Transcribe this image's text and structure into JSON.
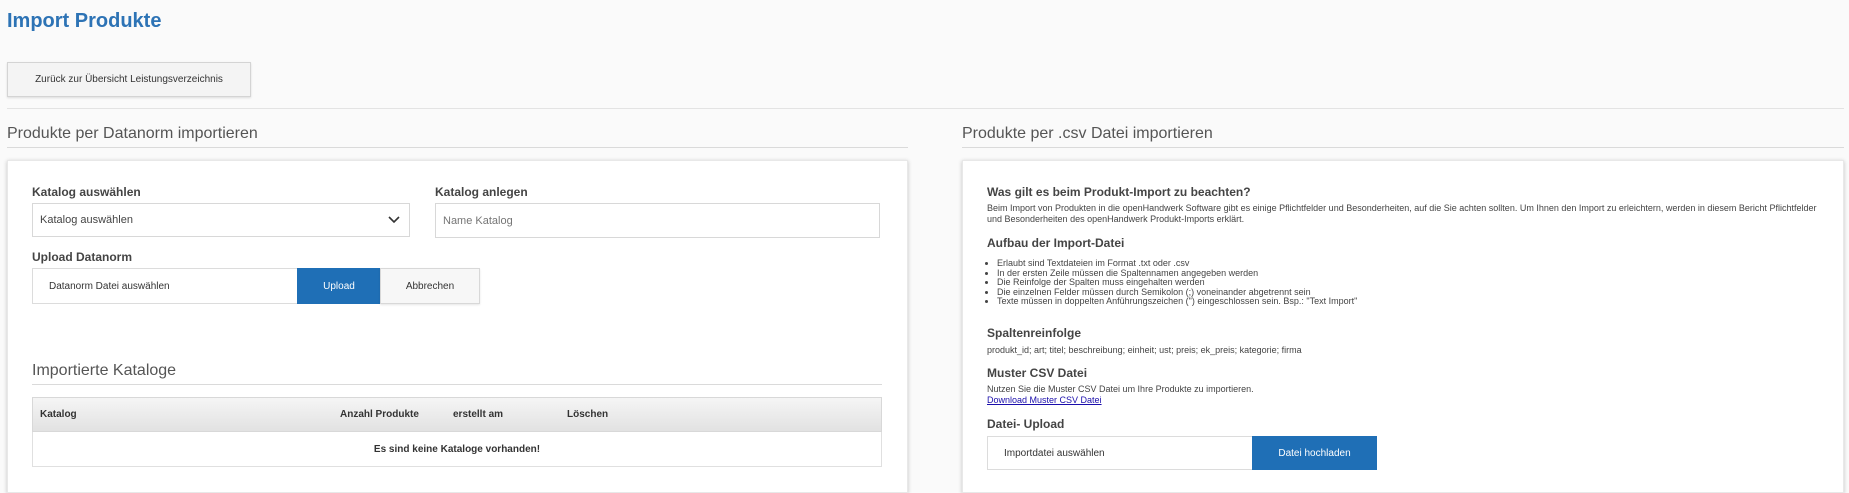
{
  "page": {
    "title": "Import Produkte",
    "back_button": "Zurück zur Übersicht Leistungsverzeichnis"
  },
  "datanorm": {
    "section_title": "Produkte per Datanorm importieren",
    "katalog_select_label": "Katalog auswählen",
    "katalog_select_value": "Katalog auswählen",
    "katalog_create_label": "Katalog anlegen",
    "katalog_create_placeholder": "Name Katalog",
    "upload_label": "Upload Datanorm",
    "upload_file_text": "Datanorm Datei auswählen",
    "upload_button": "Upload",
    "cancel_button": "Abbrechen",
    "imported_title": "Importierte Kataloge",
    "table_headers": [
      "Katalog",
      "Anzahl Produkte",
      "erstellt am",
      "Löschen"
    ],
    "empty_message": "Es sind keine Kataloge vorhanden!"
  },
  "csv": {
    "section_title": "Produkte per .csv Datei importieren",
    "intro_heading": "Was gilt es beim Produkt-Import zu beachten?",
    "intro_text": "Beim Import von Produkten in die openHandwerk Software gibt es einige Pflichtfelder und Besonderheiten, auf die Sie achten sollten. Um Ihnen den Import zu erleichtern, werden in diesem Bericht Pflichtfelder und Besonderheiten des openHandwerk Produkt-Imports erklärt.",
    "structure_heading": "Aufbau der Import-Datei",
    "structure_items": [
      "Erlaubt sind Textdateien im Format .txt oder .csv",
      "In der ersten Zeile müssen die Spaltennamen angegeben werden",
      "Die Reinfolge der Spalten muss eingehalten werden",
      "Die einzelnen Felder müssen durch Semikolon (;) voneinander abgetrennt sein",
      "Texte müssen in doppelten Anführungszeichen (\") eingeschlossen sein. Bsp.: \"Text Import\""
    ],
    "columns_heading": "Spaltenreinfolge",
    "columns_text": "produkt_id; art; titel; beschreibung; einheit; ust; preis; ek_preis; kategorie; firma",
    "sample_heading": "Muster CSV Datei",
    "sample_text": "Nutzen Sie die Muster CSV Datei um Ihre Produkte zu importieren.",
    "sample_link": "Download Muster CSV Datei",
    "upload_heading": "Datei- Upload",
    "upload_file_text": "Importdatei auswählen",
    "upload_button": "Datei hochladen"
  },
  "colors": {
    "brand": "#2d73b5",
    "primary_button": "#1f6fb6"
  }
}
